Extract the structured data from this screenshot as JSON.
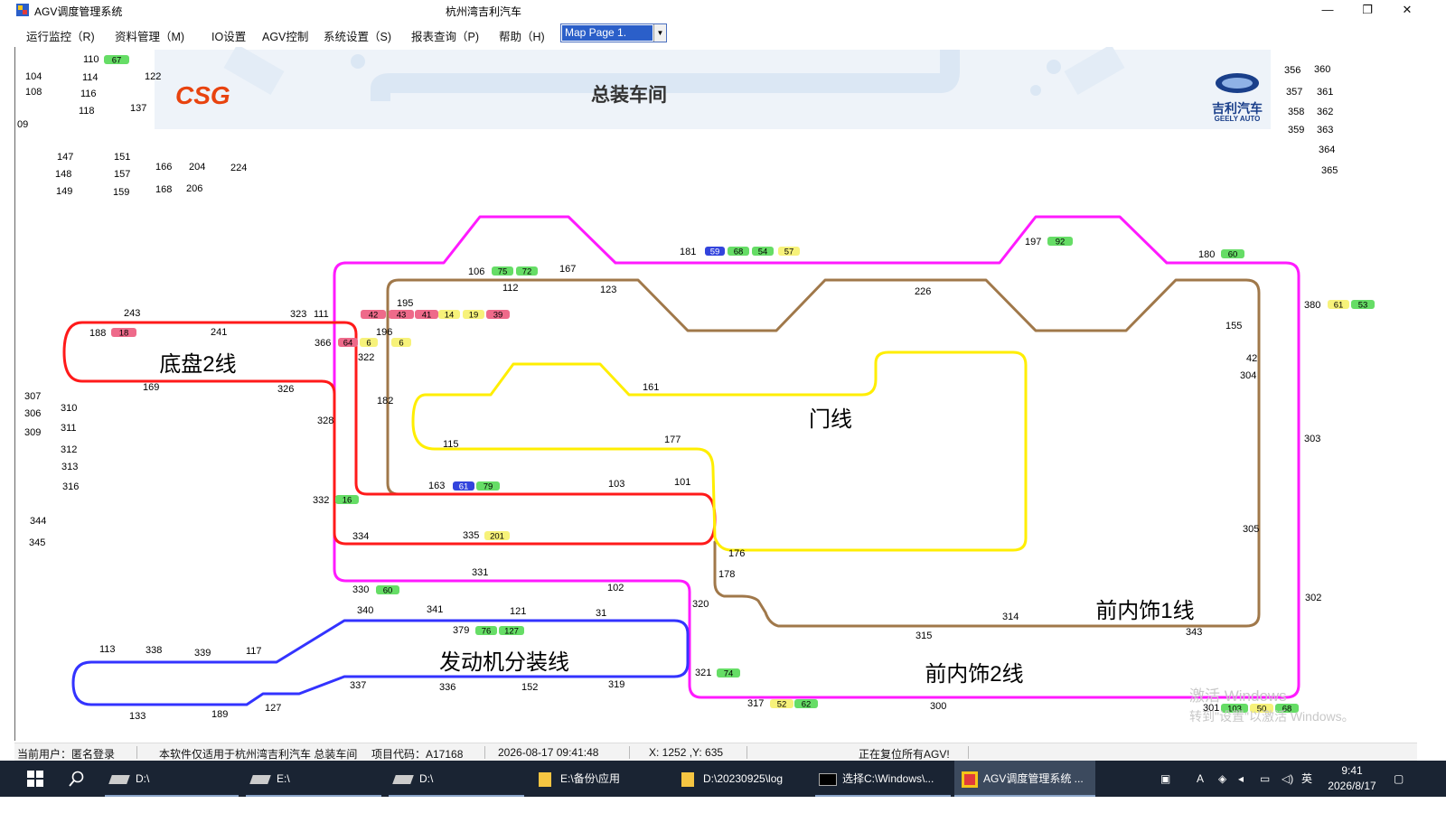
{
  "window": {
    "title": "AGV调度管理系统",
    "center_title": "杭州湾吉利汽车",
    "minimize": "—",
    "maximize": "❐",
    "close": "✕"
  },
  "menu": {
    "items": [
      "运行监控（R)",
      "资料管理（M)",
      "IO设置",
      "AGV控制",
      "系统设置（S)",
      "报表查询（P)",
      "帮助（H)"
    ],
    "map_page": "Map Page 1."
  },
  "map": {
    "header": "总装车间",
    "logo_left": "CSG",
    "logo_right": "吉利汽车",
    "logo_right_en": "GEELY AUTO",
    "watermark_line1": "激活 Windows",
    "watermark_line2": "转到\"设置\"以激活 Windows。",
    "line_labels": {
      "chassis2": "底盘2线",
      "door": "门线",
      "front_trim1": "前内饰1线",
      "front_trim2": "前内饰2线",
      "engine": "发动机分装线"
    },
    "stations": [
      "110",
      "104",
      "114",
      "122",
      "108",
      "116",
      "118",
      "137",
      "09",
      "147",
      "151",
      "148",
      "157",
      "166",
      "204",
      "224",
      "149",
      "159",
      "168",
      "206",
      "356",
      "360",
      "357",
      "361",
      "358",
      "362",
      "359",
      "363",
      "364",
      "365",
      "181",
      "197",
      "180",
      "106",
      "167",
      "112",
      "123",
      "226",
      "195",
      "243",
      "323",
      "111",
      "188",
      "241",
      "196",
      "366",
      "322",
      "380",
      "155",
      "42",
      "304",
      "169",
      "326",
      "182",
      "161",
      "307",
      "306",
      "309",
      "310",
      "311",
      "312",
      "313",
      "316",
      "328",
      "115",
      "177",
      "303",
      "163",
      "103",
      "101",
      "332",
      "305",
      "344",
      "345",
      "334",
      "335",
      "176",
      "331",
      "178",
      "330",
      "102",
      "320",
      "302",
      "340",
      "341",
      "121",
      "31",
      "314",
      "379",
      "343",
      "315",
      "113",
      "338",
      "339",
      "117",
      "321",
      "337",
      "336",
      "152",
      "319",
      "133",
      "189",
      "127",
      "317",
      "300",
      "301"
    ],
    "agvs": [
      "67",
      "59",
      "68",
      "54",
      "57",
      "92",
      "75",
      "72",
      "60",
      "61",
      "53",
      "42",
      "43",
      "41",
      "14",
      "19",
      "39",
      "18",
      "64",
      "6",
      "6",
      "61",
      "79",
      "16",
      "201",
      "60",
      "76",
      "127",
      "74",
      "52",
      "62",
      "103",
      "50",
      "68"
    ]
  },
  "status": {
    "user": "当前用户：匿名登录",
    "notice": "本软件仅适用于杭州湾吉利汽车 总装车间",
    "project": "项目代码：A17168",
    "datetime": "2026-08-17  09:41:48",
    "coords": "X:   1252 ,Y:  635",
    "message": "正在复位所有AGV!"
  },
  "taskbar": {
    "items": [
      "D:\\",
      "E:\\",
      "D:\\",
      "E:\\备份\\应用",
      "D:\\20230925\\log",
      "选择C:\\Windows\\...",
      "AGV调度管理系统 ..."
    ],
    "ime": "英",
    "time": "9:41",
    "date": "2026/8/17"
  },
  "colors": {
    "magenta": "#ff1aff",
    "red": "#ff1a1a",
    "brown": "#a0784a",
    "yellow": "#ffee00",
    "blue": "#3333ff",
    "agv_green": "#66dd66",
    "agv_yellow": "#f7f27a",
    "agv_red": "#ee6a8a",
    "agv_blue": "#3344dd",
    "taskbar": "#1a2433"
  }
}
